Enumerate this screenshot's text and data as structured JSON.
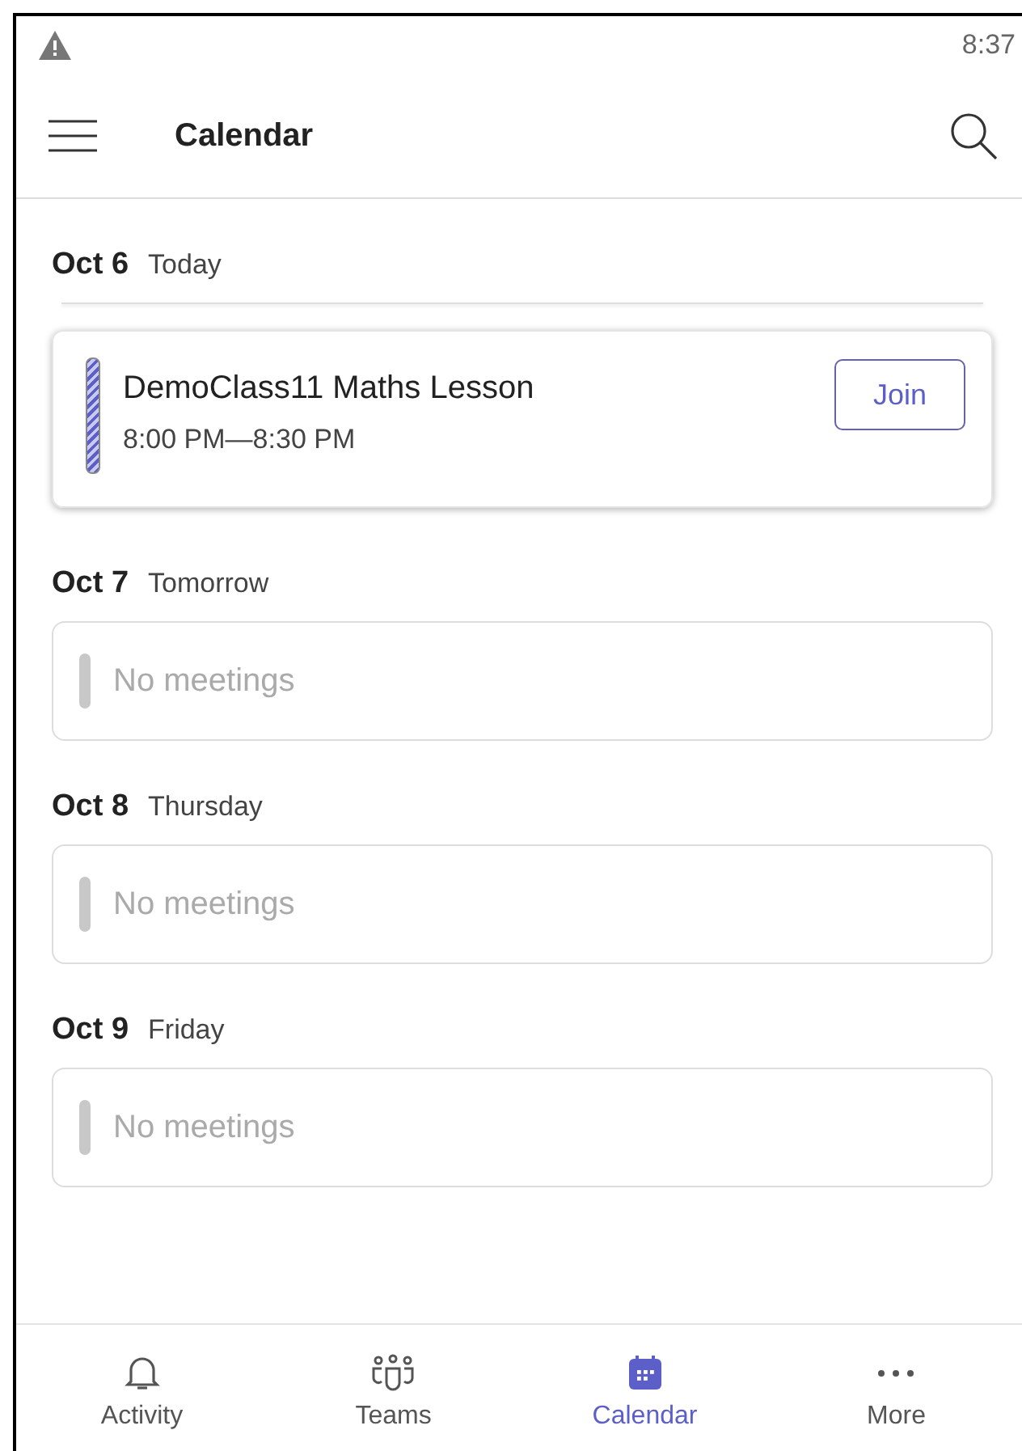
{
  "status_bar": {
    "time": "8:37"
  },
  "app_bar": {
    "title": "Calendar"
  },
  "days": [
    {
      "date": "Oct 6",
      "day": "Today",
      "items": [
        {
          "kind": "meeting",
          "title": "DemoClass11 Maths Lesson",
          "time": "8:00 PM—8:30 PM",
          "action": "Join"
        }
      ]
    },
    {
      "date": "Oct 7",
      "day": "Tomorrow",
      "items": [
        {
          "kind": "empty",
          "text": "No meetings"
        }
      ]
    },
    {
      "date": "Oct 8",
      "day": "Thursday",
      "items": [
        {
          "kind": "empty",
          "text": "No meetings"
        }
      ]
    },
    {
      "date": "Oct 9",
      "day": "Friday",
      "items": [
        {
          "kind": "empty",
          "text": "No meetings"
        }
      ]
    }
  ],
  "nav": [
    {
      "label": "Activity",
      "kind": "bell",
      "selected": false
    },
    {
      "label": "Teams",
      "kind": "teams",
      "selected": false
    },
    {
      "label": "Calendar",
      "kind": "calendar",
      "selected": true
    },
    {
      "label": "More",
      "kind": "more",
      "selected": false
    }
  ]
}
